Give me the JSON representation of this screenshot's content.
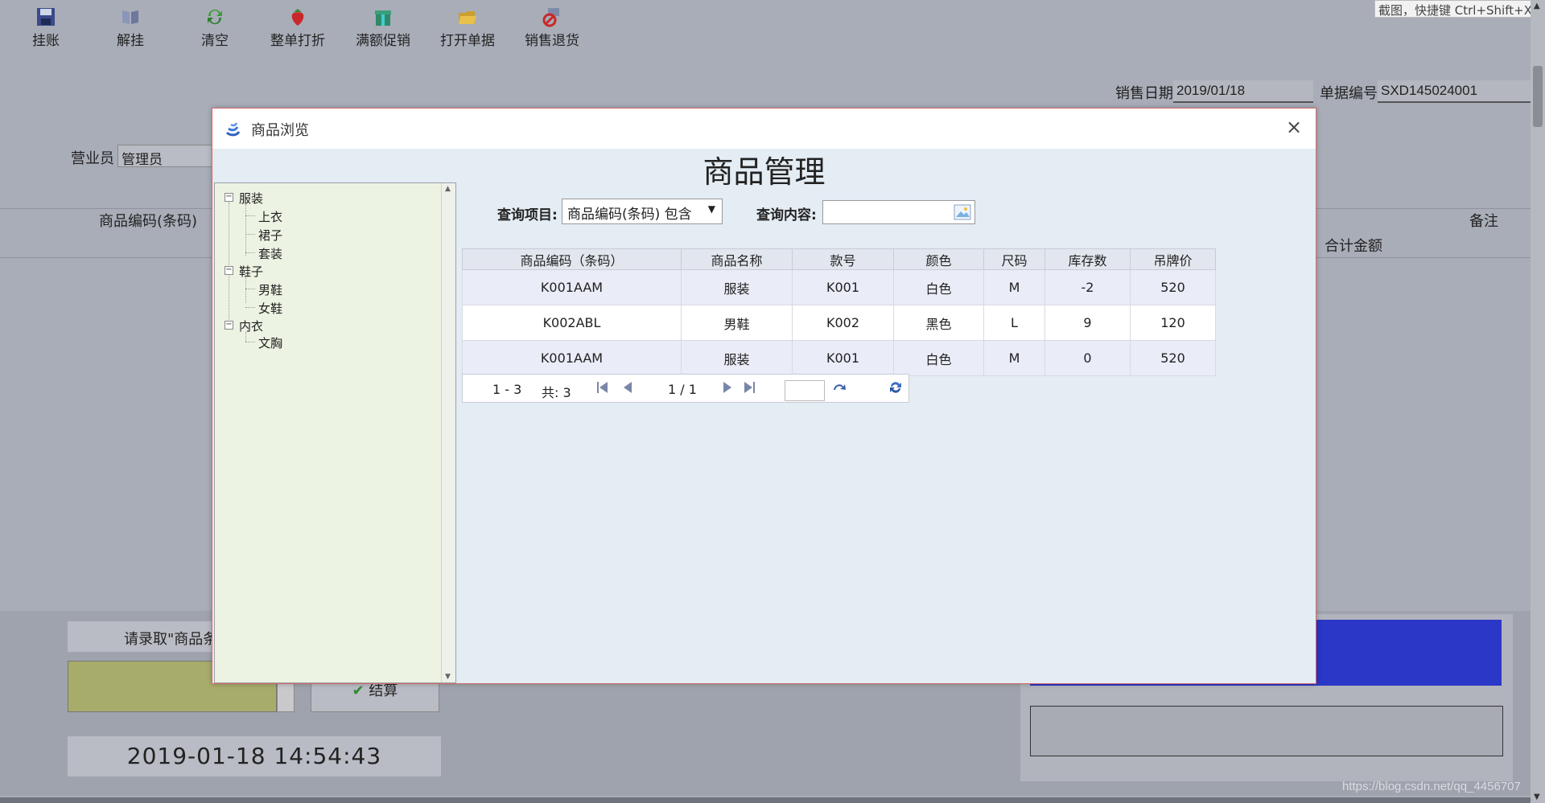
{
  "toolbar": {
    "items": [
      {
        "label": "挂账",
        "icon": "floppy-disk-icon"
      },
      {
        "label": "解挂",
        "icon": "open-book-icon"
      },
      {
        "label": "清空",
        "icon": "refresh-icon"
      },
      {
        "label": "整单打折",
        "icon": "strawberry-icon"
      },
      {
        "label": "满额促销",
        "icon": "gift-box-icon"
      },
      {
        "label": "打开单据",
        "icon": "folder-icon"
      },
      {
        "label": "销售退货",
        "icon": "return-icon"
      }
    ]
  },
  "screenshot_tip": "截图，快捷键 Ctrl+Shift+X",
  "sale_meta": {
    "date_label": "销售日期",
    "date_value": "2019/01/18",
    "bill_label": "单据编号",
    "bill_value": "SXD145024001"
  },
  "clerk": {
    "label": "营业员",
    "value": "管理员"
  },
  "page_grid": {
    "barcode_header": "商品编码(条码)",
    "remark_header": "备注",
    "total_header": "合计金额"
  },
  "bottom": {
    "hint": "请录取\"商品条",
    "settle_label": "结算",
    "clock": "2019-01-18 14:54:43",
    "watermark": "https://blog.csdn.net/qq_4456707"
  },
  "dialog": {
    "title": "商品浏览",
    "heading": "商品管理",
    "query_item_label": "查询项目:",
    "query_item_value": "商品编码(条码) 包含",
    "query_content_label": "查询内容:",
    "query_content_value": "",
    "tree": [
      {
        "label": "服装",
        "children": [
          "上衣",
          "裙子",
          "套装"
        ]
      },
      {
        "label": "鞋子",
        "children": [
          "男鞋",
          "女鞋"
        ]
      },
      {
        "label": "内衣",
        "children": [
          "文胸"
        ]
      }
    ],
    "table": {
      "columns": [
        "商品编码（条码）",
        "商品名称",
        "款号",
        "颜色",
        "尺码",
        "库存数",
        "吊牌价"
      ],
      "rows": [
        [
          "K001AAM",
          "服装",
          "K001",
          "白色",
          "M",
          "-2",
          "520"
        ],
        [
          "K002ABL",
          "男鞋",
          "K002",
          "黑色",
          "L",
          "9",
          "120"
        ],
        [
          "K001AAM",
          "服装",
          "K001",
          "白色",
          "M",
          "0",
          "520"
        ]
      ]
    },
    "pager": {
      "range": "1 - 3",
      "total": "共: 3",
      "page": "1 / 1"
    }
  },
  "colors": {
    "blue_display": "#2a37c7",
    "tree_bg": "#edf3e3",
    "dialog_body": "#e4ecf4",
    "dialog_border": "#d46a6a"
  }
}
